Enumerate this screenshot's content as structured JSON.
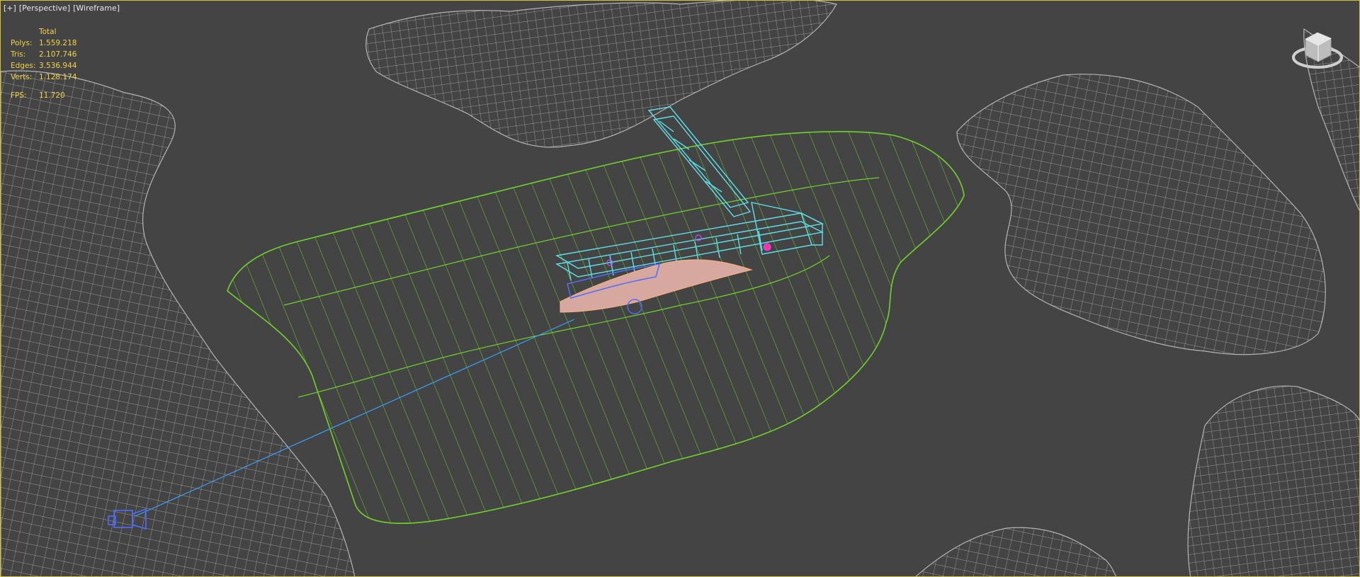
{
  "viewport": {
    "labels": {
      "plus": "[+]",
      "view": "[Perspective]",
      "shading": "[Wireframe]"
    },
    "stats": {
      "header": "Total",
      "polys_label": "Polys:",
      "polys": "1.559.218",
      "tris_label": "Tris:",
      "tris": "2.107.746",
      "edges_label": "Edges:",
      "edges": "3.536.944",
      "verts_label": "Verts:",
      "verts": "1.128.174",
      "fps_label": "FPS:",
      "fps": "11.720"
    }
  },
  "colors": {
    "viewport_bg": "#444444",
    "active_border": "#d6c03a",
    "stats_text": "#f2d24a",
    "terrain_wire": "#b4b4b4",
    "water_wire": "#6fd22a",
    "building_wire": "#5ee0e8",
    "camera_wire": "#4f6cff",
    "camera_line": "#3aa0ff"
  },
  "icons": {
    "viewcube": "viewcube-icon",
    "camera": "camera-icon"
  }
}
